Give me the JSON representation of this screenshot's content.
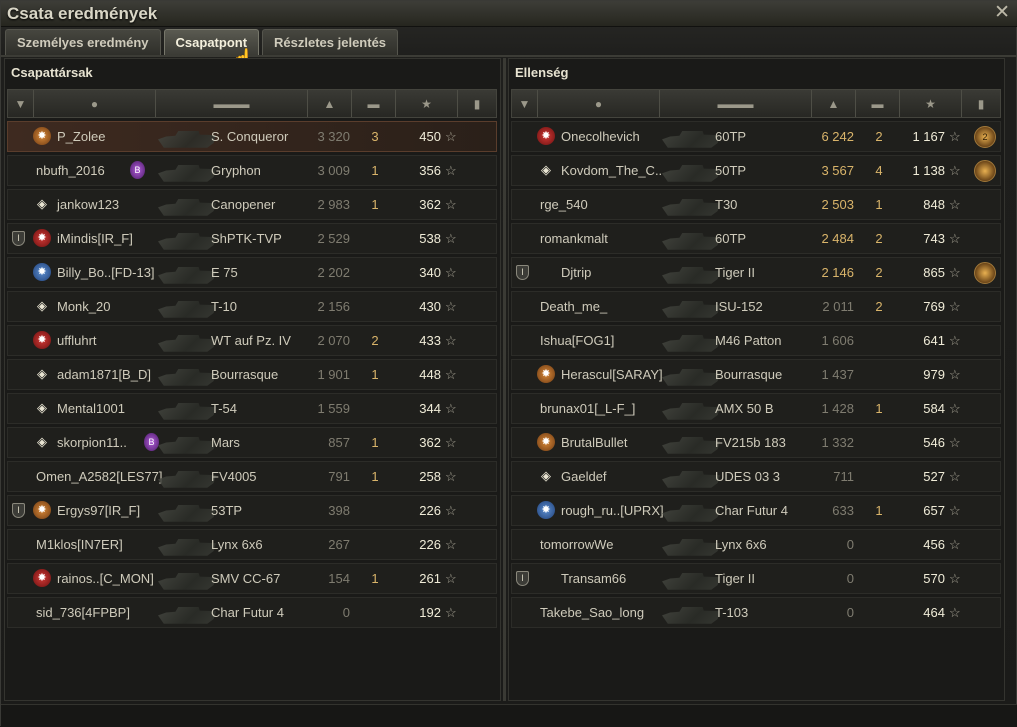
{
  "window": {
    "title": "Csata eredmények",
    "close": "✕"
  },
  "tabs": [
    {
      "label": "Személyes eredmény",
      "active": false
    },
    {
      "label": "Csapatpont",
      "active": true
    },
    {
      "label": "Részletes jelentés",
      "active": false
    }
  ],
  "allies": {
    "title": "Csapattársak",
    "rows": [
      {
        "badge": "orange",
        "name": "P_Zolee",
        "tank": "S. Conqueror",
        "xp": "3 320",
        "kills": "3",
        "points": "450",
        "me": true
      },
      {
        "badge": "none",
        "name": "nbufh_2016",
        "extra": "purple",
        "tank": "Gryphon",
        "xp": "3 009",
        "kills": "1",
        "points": "356"
      },
      {
        "badge": "diamond",
        "name": "jankow123",
        "tank": "Canopener",
        "xp": "2 983",
        "kills": "1",
        "points": "362"
      },
      {
        "badge": "red",
        "mark": true,
        "name": "iMindis[IR_F]",
        "tank": "ShPTK-TVP",
        "xp": "2 529",
        "kills": "",
        "points": "538"
      },
      {
        "badge": "blue",
        "name": "Billy_Bo..[FD-13]",
        "tank": "E 75",
        "xp": "2 202",
        "kills": "",
        "points": "340"
      },
      {
        "badge": "diamond",
        "name": "Monk_20",
        "tank": "T-10",
        "xp": "2 156",
        "kills": "",
        "points": "430"
      },
      {
        "badge": "red",
        "name": "uffluhrt",
        "tank": "WT auf Pz. IV",
        "xp": "2 070",
        "kills": "2",
        "points": "433"
      },
      {
        "badge": "diamond",
        "name": "adam1871[B_D]",
        "tank": "Bourrasque",
        "xp": "1 901",
        "kills": "1",
        "points": "448"
      },
      {
        "badge": "diamond",
        "name": "Mental1001",
        "tank": "T-54",
        "xp": "1 559",
        "kills": "",
        "points": "344"
      },
      {
        "badge": "diamond",
        "name": "skorpion11..",
        "extra": "purple",
        "tank": "Mars",
        "xp": "857",
        "kills": "1",
        "points": "362"
      },
      {
        "badge": "none",
        "name": "Omen_A2582[LES77]",
        "tank": "FV4005",
        "xp": "791",
        "kills": "1",
        "points": "258"
      },
      {
        "badge": "orange",
        "mark": true,
        "name": "Ergys97[IR_F]",
        "tank": "53TP",
        "xp": "398",
        "kills": "",
        "points": "226"
      },
      {
        "badge": "none",
        "name": "M1klos[IN7ER]",
        "tank": "Lynx 6x6",
        "xp": "267",
        "kills": "",
        "points": "226"
      },
      {
        "badge": "red",
        "name": "rainos..[C_MON]",
        "tank": "SMV CC-67",
        "xp": "154",
        "kills": "1",
        "points": "261"
      },
      {
        "badge": "none",
        "name": "sid_736[4FPBP]",
        "tank": "Char Futur 4",
        "xp": "0",
        "kills": "",
        "points": "192"
      }
    ]
  },
  "enemies": {
    "title": "Ellenség",
    "rows": [
      {
        "badge": "red",
        "name": "Onecolhevich",
        "tank": "60TP",
        "xp": "6 242",
        "kills": "2",
        "points": "1 167",
        "medal": "2"
      },
      {
        "badge": "diamond",
        "name": "Kovdom_The_C..",
        "tank": "50TP",
        "xp": "3 567",
        "kills": "4",
        "points": "1 138",
        "medal": ""
      },
      {
        "badge": "none",
        "name": "rge_540",
        "tank": "T30",
        "xp": "2 503",
        "kills": "1",
        "points": "848"
      },
      {
        "badge": "none",
        "name": "romankmalt",
        "tank": "60TP",
        "xp": "2 484",
        "kills": "2",
        "points": "743"
      },
      {
        "badge": "none",
        "mark": true,
        "name": "Djtrip",
        "tank": "Tiger II",
        "xp": "2 146",
        "kills": "2",
        "points": "865",
        "medal": ""
      },
      {
        "badge": "none",
        "name": "Death_me_",
        "tank": "ISU-152",
        "xp": "2 011",
        "kills": "2",
        "points": "769"
      },
      {
        "badge": "none",
        "name": "Ishua[FOG1]",
        "tank": "M46 Patton",
        "xp": "1 606",
        "kills": "",
        "points": "641"
      },
      {
        "badge": "orange",
        "name": "Herascul[SARAY]",
        "tank": "Bourrasque",
        "xp": "1 437",
        "kills": "",
        "points": "979"
      },
      {
        "badge": "none",
        "name": "brunax01[_L-F_]",
        "tank": "AMX 50 B",
        "xp": "1 428",
        "kills": "1",
        "points": "584"
      },
      {
        "badge": "orange",
        "name": "BrutalBullet",
        "tank": "FV215b 183",
        "xp": "1 332",
        "kills": "",
        "points": "546"
      },
      {
        "badge": "diamond",
        "name": "Gaeldef",
        "tank": "UDES 03 3",
        "xp": "711",
        "kills": "",
        "points": "527"
      },
      {
        "badge": "blue",
        "name": "rough_ru..[UPRX]",
        "tank": "Char Futur 4",
        "xp": "633",
        "kills": "1",
        "points": "657"
      },
      {
        "badge": "none",
        "name": "tomorrowWe",
        "tank": "Lynx 6x6",
        "xp": "0",
        "kills": "",
        "points": "456"
      },
      {
        "badge": "none",
        "mark": true,
        "name": "Transam66",
        "tank": "Tiger II",
        "xp": "0",
        "kills": "",
        "points": "570"
      },
      {
        "badge": "none",
        "name": "Takebe_Sao_long",
        "tank": "T-103",
        "xp": "0",
        "kills": "",
        "points": "464"
      }
    ]
  }
}
